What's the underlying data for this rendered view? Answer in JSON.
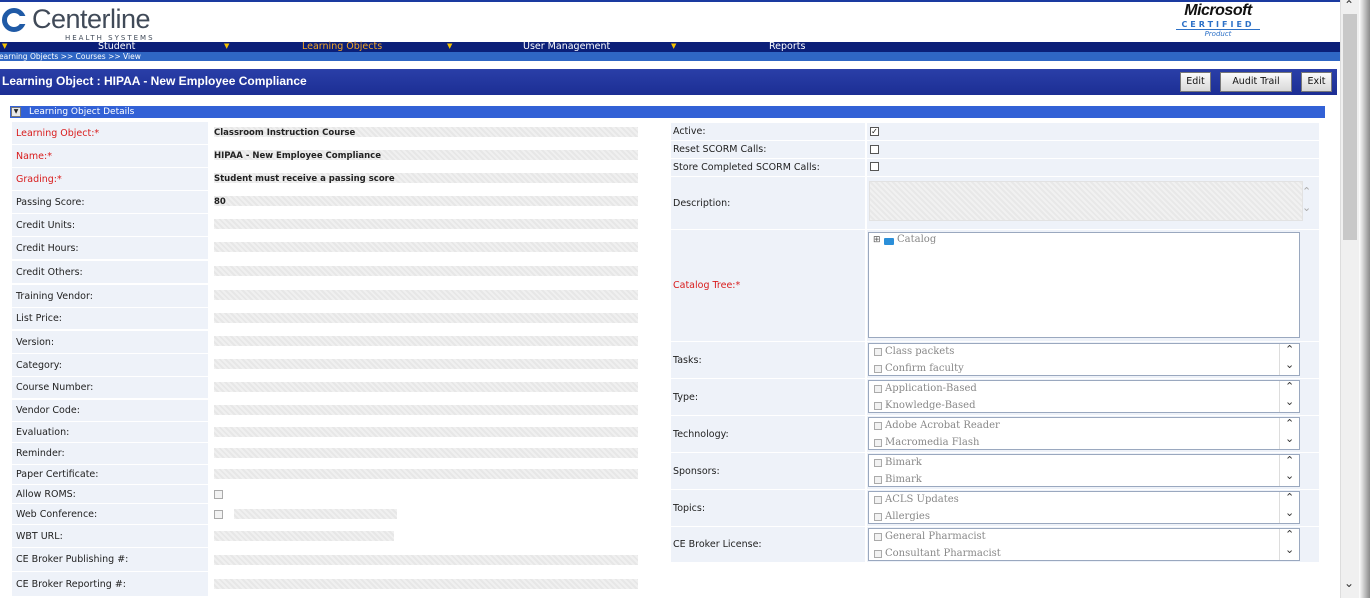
{
  "brand": {
    "name": "Centerline",
    "subtitle": "HEALTH SYSTEMS",
    "badge": {
      "line1": "Microsoft",
      "line2": "CERTIFIED",
      "line3": "Product"
    }
  },
  "nav": {
    "items": [
      {
        "label": "Student",
        "active": false
      },
      {
        "label": "Learning Objects",
        "active": true
      },
      {
        "label": "User Management",
        "active": false
      },
      {
        "label": "Reports",
        "active": false
      }
    ],
    "arrow": "▼"
  },
  "breadcrumb": "Learning Objects >> Courses >> View",
  "page": {
    "title": "Learning Object : HIPAA - New Employee Compliance",
    "buttons": {
      "edit": "Edit",
      "audit": "Audit Trail",
      "exit": "Exit"
    }
  },
  "section": {
    "title": "Learning Object Details",
    "toggle": "▼"
  },
  "left_fields": [
    {
      "label": "Learning Object:",
      "required": true,
      "value": "Classroom Instruction Course"
    },
    {
      "label": "Name:",
      "required": true,
      "value": "HIPAA - New Employee Compliance"
    },
    {
      "label": "Grading:",
      "required": true,
      "value": "Student must receive a passing score"
    },
    {
      "label": "Passing Score:",
      "required": false,
      "value": "80"
    },
    {
      "label": "Credit Units:",
      "required": false,
      "value": ""
    },
    {
      "label": "Credit Hours:",
      "required": false,
      "value": ""
    },
    {
      "label": "Credit Others:",
      "required": false,
      "value": ""
    },
    {
      "label": "Training Vendor:",
      "required": false,
      "value": ""
    },
    {
      "label": "List Price:",
      "required": false,
      "value": ""
    },
    {
      "label": "Version:",
      "required": false,
      "value": ""
    },
    {
      "label": "Category:",
      "required": false,
      "value": ""
    },
    {
      "label": "Course Number:",
      "required": false,
      "value": ""
    },
    {
      "label": "Vendor Code:",
      "required": false,
      "value": ""
    },
    {
      "label": "Evaluation:",
      "required": false,
      "value": ""
    },
    {
      "label": "Reminder:",
      "required": false,
      "value": ""
    },
    {
      "label": "Paper Certificate:",
      "required": false,
      "value": ""
    },
    {
      "label": "Allow ROMS:",
      "required": false,
      "value": ""
    },
    {
      "label": "Web Conference:",
      "required": false,
      "value": ""
    },
    {
      "label": "WBT URL:",
      "required": false,
      "value": ""
    },
    {
      "label": "CE Broker Publishing #:",
      "required": false,
      "value": ""
    },
    {
      "label": "CE Broker Reporting #:",
      "required": false,
      "value": ""
    }
  ],
  "required_mark": "*",
  "right": {
    "active": {
      "label": "Active:",
      "checked": true
    },
    "reset_scorm": {
      "label": "Reset SCORM Calls:",
      "checked": false
    },
    "store_scorm": {
      "label": "Store Completed SCORM Calls:",
      "checked": false
    },
    "description": {
      "label": "Description:"
    },
    "catalog_tree": {
      "label": "Catalog Tree:",
      "required": true,
      "root": "Catalog",
      "expander": "⊞"
    },
    "lists": [
      {
        "label": "Tasks:",
        "options": [
          "Class packets",
          "Confirm faculty"
        ]
      },
      {
        "label": "Type:",
        "options": [
          "Application-Based",
          "Knowledge-Based"
        ]
      },
      {
        "label": "Technology:",
        "options": [
          "Adobe Acrobat Reader",
          "Macromedia Flash"
        ]
      },
      {
        "label": "Sponsors:",
        "options": [
          "Bimark",
          "Bimark"
        ]
      },
      {
        "label": "Topics:",
        "options": [
          "ACLS Updates",
          "Allergies"
        ]
      },
      {
        "label": "CE Broker License:",
        "options": [
          "General Pharmacist",
          "Consultant Pharmacist"
        ]
      }
    ]
  },
  "checkmark": "✓",
  "scroll_up": "⌃",
  "scroll_down": "⌄"
}
